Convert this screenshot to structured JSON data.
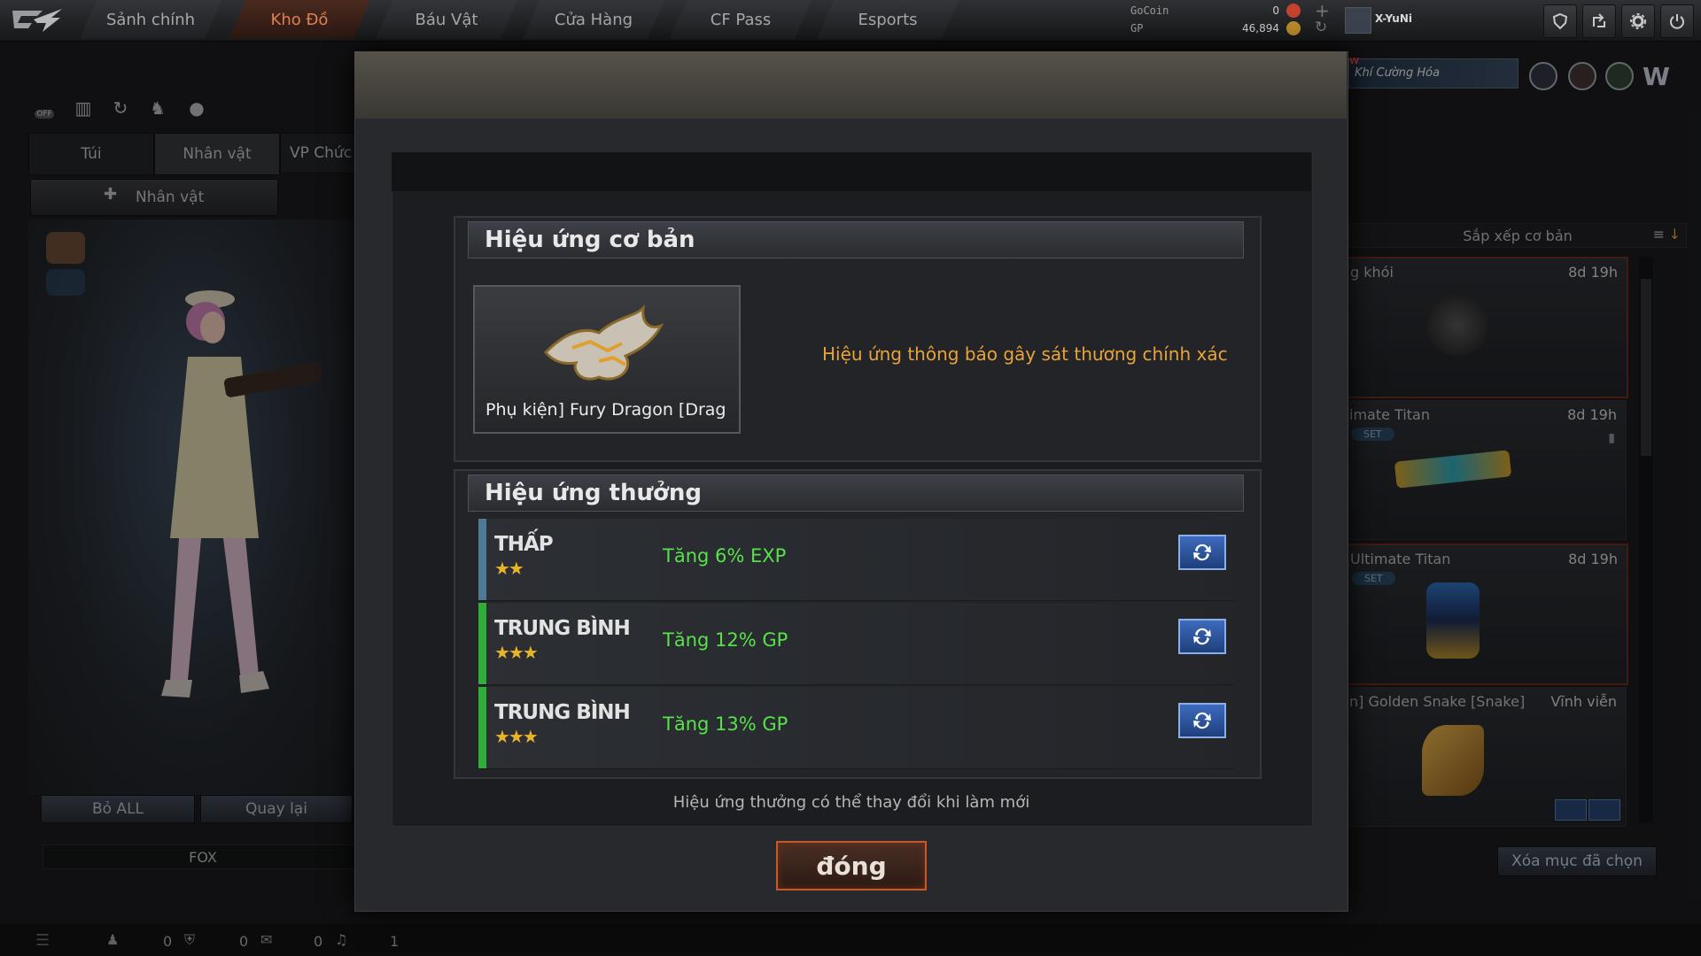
{
  "nav": {
    "tabs": [
      "Sảnh chính",
      "Kho Đồ",
      "Báu Vật",
      "Cửa Hàng",
      "CF Pass",
      "Esports"
    ],
    "active_tab": "Kho Đồ"
  },
  "currency": {
    "gocoin_label": "GoCoin",
    "gocoin_value": "0",
    "gp_label": "GP",
    "gp_value": "46,894"
  },
  "user": {
    "name": "X-YuNi"
  },
  "promo": {
    "new_badge": "W",
    "text": "Khí Cường Hóa"
  },
  "left_panel": {
    "off_label": "OFF",
    "tabs": [
      "Túi",
      "Nhân vật",
      "VP Chức"
    ],
    "active_tab": "Nhân vật",
    "subtab": "Nhân vật",
    "buttons": {
      "remove_all": "Bỏ ALL",
      "back": "Quay lại"
    },
    "character_name": "FOX"
  },
  "right_panel": {
    "sort_label": "Sắp xếp cơ bản",
    "items": [
      {
        "name": "g khói",
        "time": "8d 19h",
        "set": ""
      },
      {
        "name": "imate Titan",
        "time": "8d 19h",
        "set": "SET"
      },
      {
        "name": "Ultimate Titan",
        "time": "8d 19h",
        "set": "SET"
      },
      {
        "name": "n] Golden Snake [Snake]",
        "time": "Vĩnh viễn",
        "set": ""
      }
    ],
    "clear_button": "Xóa mục đã chọn"
  },
  "bottom_bar": {
    "counts": [
      "0",
      "0",
      "0",
      "1"
    ]
  },
  "modal": {
    "basic_title": "Hiệu ứng cơ bản",
    "item_name": "Phụ kiện] Fury Dragon [Drag",
    "basic_effect": "Hiệu ứng thông báo gây sát thương chính xác",
    "bonus_title": "Hiệu ứng thưởng",
    "bonus_rows": [
      {
        "tier": "THẤP",
        "stars": "★★",
        "reward": "Tăng 6% EXP",
        "color": "#4f7a95"
      },
      {
        "tier": "TRUNG BÌNH",
        "stars": "★★★",
        "reward": "Tăng 12% GP",
        "color": "#2fae3a"
      },
      {
        "tier": "TRUNG BÌNH",
        "stars": "★★★",
        "reward": "Tăng 13% GP",
        "color": "#2fae3a"
      }
    ],
    "note": "Hiệu ứng thưởng có thể thay đổi khi làm mới",
    "close_button": "đóng"
  },
  "colors": {
    "accent_orange": "#e8a33a",
    "reward_green": "#58e24a",
    "active_tab": "#e07f4f"
  }
}
